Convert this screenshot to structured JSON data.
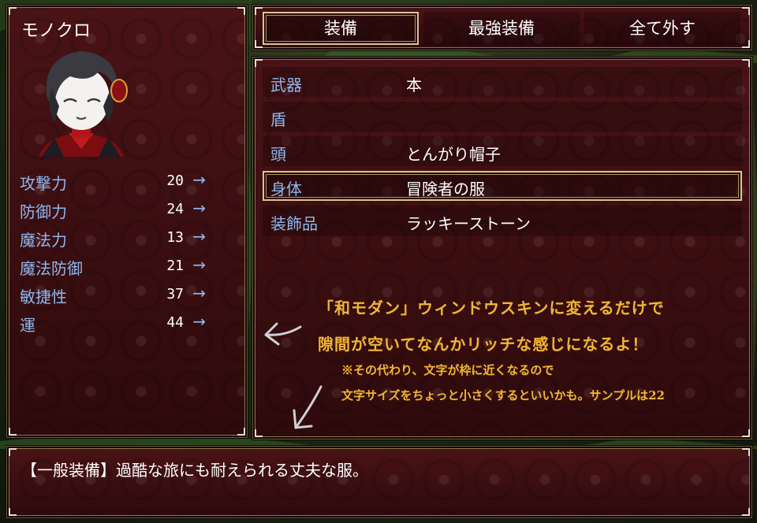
{
  "status": {
    "actor_name": "モノクロ",
    "params": [
      {
        "label": "攻撃力",
        "value": "20",
        "arrow": "→"
      },
      {
        "label": "防御力",
        "value": "24",
        "arrow": "→"
      },
      {
        "label": "魔法力",
        "value": "13",
        "arrow": "→"
      },
      {
        "label": "魔法防御",
        "value": "21",
        "arrow": "→"
      },
      {
        "label": "敏捷性",
        "value": "37",
        "arrow": "→"
      },
      {
        "label": "運",
        "value": "44",
        "arrow": "→"
      }
    ]
  },
  "commands": [
    {
      "label": "装備",
      "selected": true
    },
    {
      "label": "最強装備",
      "selected": false
    },
    {
      "label": "全て外す",
      "selected": false
    }
  ],
  "slots": [
    {
      "name": "武器",
      "item": "本"
    },
    {
      "name": "盾",
      "item": ""
    },
    {
      "name": "頭",
      "item": "とんがり帽子"
    },
    {
      "name": "身体",
      "item": "冒険者の服",
      "selected": true
    },
    {
      "name": "装飾品",
      "item": "ラッキーストーン"
    }
  ],
  "annotation": {
    "line1": "「和モダン」ウィンドウスキンに変えるだけで",
    "line2": "隙間が空いてなんかリッチな感じになるよ！",
    "line3": "※その代わり、文字が枠に近くなるので",
    "line4": "文字サイズをちょっと小さくするといいかも。サンプルは22",
    "color": "#f2b637"
  },
  "help": {
    "text": "【一般装備】過酷な旅にも耐えられる丈夫な服。"
  },
  "colors": {
    "system_blue": "#8fb8ef",
    "window_bg": "#3a0d10",
    "frame_gold": "#d9c68d"
  },
  "icons": [
    "portrait-image",
    "left-arrow-doodle",
    "down-left-arrow-doodle",
    "corner-bracket-icon"
  ]
}
